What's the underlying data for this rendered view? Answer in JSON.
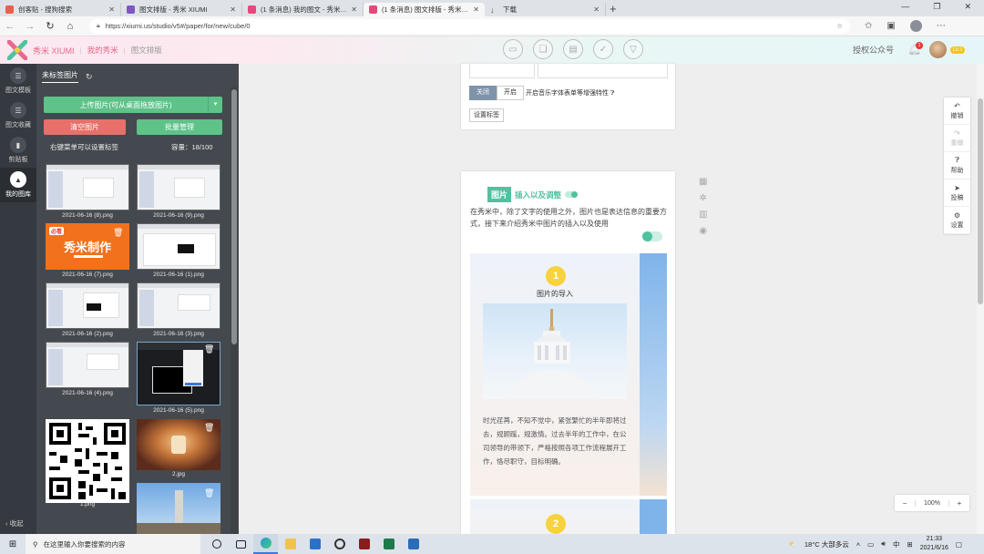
{
  "browser": {
    "tabs": [
      {
        "title": "创客贴 - 搜狗搜索",
        "color": "#e8604c"
      },
      {
        "title": "图文排版 - 秀米 XIUMI",
        "color": "#7e57c2"
      },
      {
        "title": "(1 条消息) 我的图文 - 秀米 XIUMI",
        "color": "#e5487a"
      },
      {
        "title": "(1 条消息) 图文排版 - 秀米 XIUMI",
        "color": "#e5487a"
      },
      {
        "title": "下载",
        "color": "#555"
      }
    ],
    "new_tab": "+",
    "url": "https://xiumi.us/studio/v5#/paper/for/new/cube/0"
  },
  "header": {
    "brand": "秀米 XIUMI",
    "nav": [
      "我的秀米",
      "图文排版"
    ],
    "auth_label": "授权公众号",
    "notif_count": "1",
    "level": "LV.1"
  },
  "rail": {
    "items": [
      {
        "label": "图文模板",
        "icon": "template-icon"
      },
      {
        "label": "图文收藏",
        "icon": "favorite-icon"
      },
      {
        "label": "剪贴板",
        "icon": "clipboard-icon"
      },
      {
        "label": "我的图库",
        "icon": "gallery-icon"
      }
    ],
    "collapse": "收起"
  },
  "library": {
    "tab": "未标签图片",
    "upload_label": "上传图片(可从桌面拖放图片)",
    "clear_label": "清空图片",
    "batch_label": "批量管理",
    "hint": "右键菜单可以设置标签",
    "capacity": "容量：18/100",
    "images": [
      "2021-06-16 (8).png",
      "2021-06-16 (9).png",
      "2021-06-16 (7).png",
      "2021-06-16 (1).png",
      "2021-06-16 (2).png",
      "2021-06-16 (3).png",
      "2021-06-16 (4).png",
      "2021-06-16 (5).png",
      "1.png",
      "2.jpg"
    ],
    "promo_text": "秀米制作",
    "promo_tag": "必看"
  },
  "editor": {
    "seg_off": "关闭",
    "seg_on": "开启",
    "note": "开启音乐字体表单等增强特性",
    "tag_btn": "设置标签",
    "section_tag": "图片",
    "section_title": "插入以及调整",
    "intro": "在秀米中，除了文字的使用之外，图片也是表达信息的重要方式，接下来介绍秀米中图片的插入以及使用",
    "step1_num": "1",
    "step1_title": "图片的导入",
    "step1_body": "时光荏苒，不知不觉中，紧张繁忙的半年即将过去，规顾蹊，规激情。过去半年的工作中，在公司领导的带领下，严格按照各项工作流程展开工作，恪尽职守，目标明确。",
    "step2_num": "2"
  },
  "right_tools": [
    {
      "label": "撤销",
      "icon": "undo-icon"
    },
    {
      "label": "重做",
      "icon": "redo-icon"
    },
    {
      "label": "帮助",
      "icon": "help-icon"
    },
    {
      "label": "投稿",
      "icon": "send-icon"
    },
    {
      "label": "设置",
      "icon": "settings-icon"
    }
  ],
  "zoom": {
    "minus": "−",
    "value": "100%",
    "plus": "+"
  },
  "taskbar": {
    "search_placeholder": "在这里输入你要搜索的内容",
    "weather": "18°C  大部多云",
    "ime": "中",
    "time": "21:33",
    "date": "2021/6/16"
  }
}
